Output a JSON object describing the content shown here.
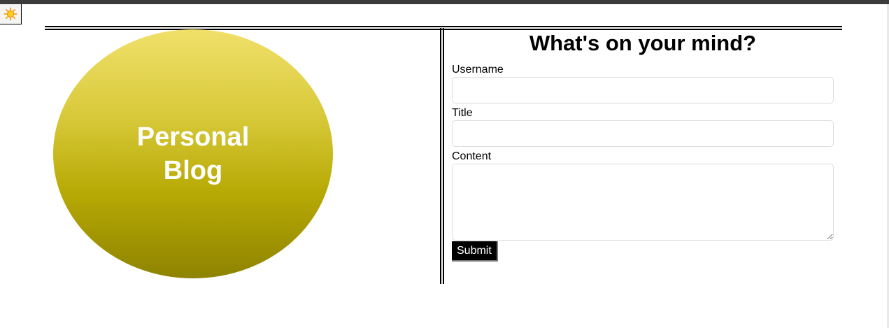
{
  "theme_toggle": {
    "icon": "sun-icon"
  },
  "logo": {
    "line1": "Personal",
    "line2": "Blog",
    "gradient": [
      "#f1e06a",
      "#8e8300"
    ]
  },
  "form": {
    "title": "What's on your mind?",
    "username_label": "Username",
    "username_value": "",
    "title_label": "Title",
    "title_value": "",
    "content_label": "Content",
    "content_value": "",
    "submit_label": "Submit"
  }
}
